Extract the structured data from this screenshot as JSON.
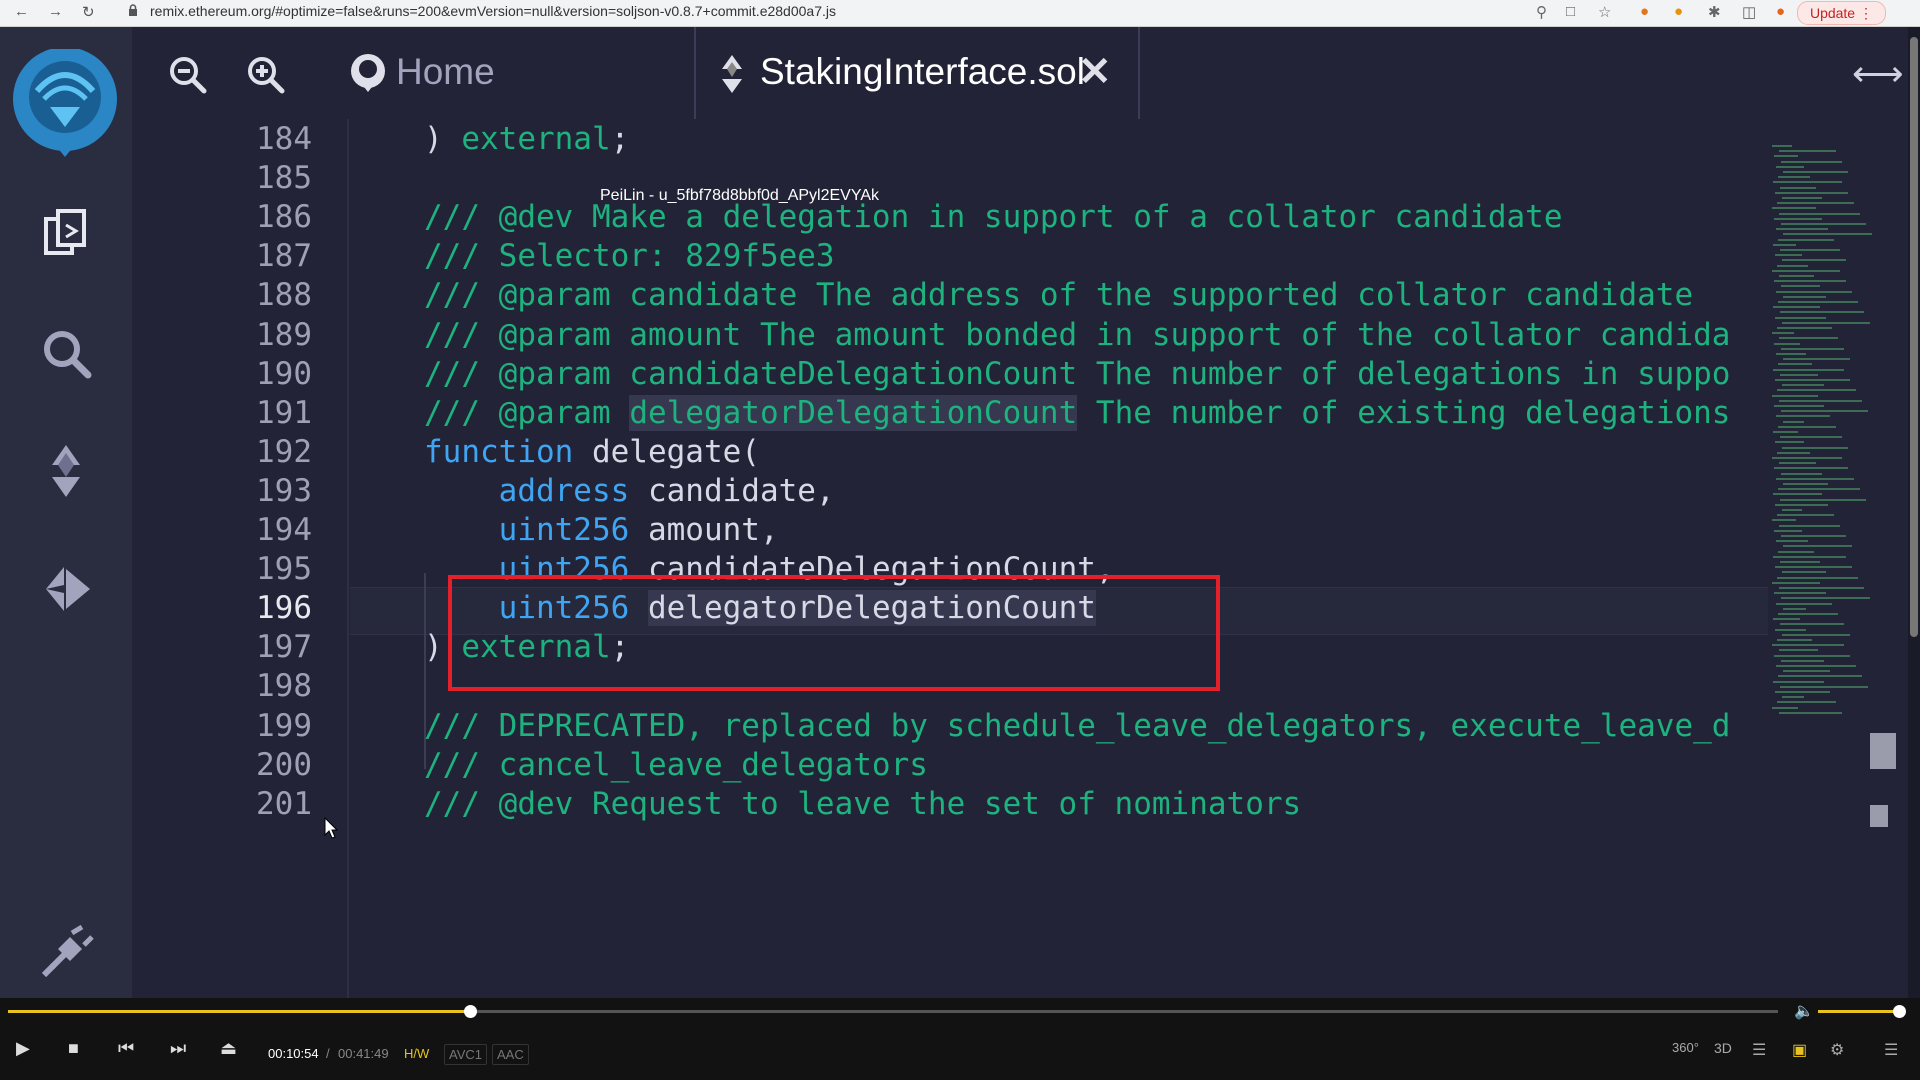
{
  "browser": {
    "url": "remix.ethereum.org/#optimize=false&runs=200&evmVersion=null&version=soljson-v0.8.7+commit.e28d00a7.js",
    "update_label": "Update"
  },
  "tabs": {
    "home_label": "Home",
    "file_label": "StakingInterface.sol"
  },
  "watermark": "PeiLin - u_5fbf78d8bbf0d_APyl2EVYAk",
  "editor": {
    "current_line": "196",
    "lines": [
      {
        "n": "184",
        "parts": [
          {
            "t": ") ",
            "c": ""
          },
          {
            "t": "external",
            "c": "cm"
          },
          {
            "t": ";",
            "c": ""
          }
        ]
      },
      {
        "n": "185",
        "parts": []
      },
      {
        "n": "186",
        "parts": [
          {
            "t": "/// @dev Make a delegation in support of a collator candidate",
            "c": "cm"
          }
        ]
      },
      {
        "n": "187",
        "parts": [
          {
            "t": "/// Selector: 829f5ee3",
            "c": "cm"
          }
        ]
      },
      {
        "n": "188",
        "parts": [
          {
            "t": "/// @param candidate The address of the supported collator candidate",
            "c": "cm"
          }
        ]
      },
      {
        "n": "189",
        "parts": [
          {
            "t": "/// @param amount The amount bonded in support of the collator candida",
            "c": "cm"
          }
        ]
      },
      {
        "n": "190",
        "parts": [
          {
            "t": "/// @param candidateDelegationCount The number of delegations in suppo",
            "c": "cm"
          }
        ]
      },
      {
        "n": "191",
        "parts": [
          {
            "t": "/// @param ",
            "c": "cm"
          },
          {
            "t": "delegatorDelegationCount",
            "c": "cm hl"
          },
          {
            "t": " The number of existing delegations",
            "c": "cm"
          }
        ]
      },
      {
        "n": "192",
        "parts": [
          {
            "t": "function",
            "c": "kw"
          },
          {
            "t": " delegate(",
            "c": ""
          }
        ]
      },
      {
        "n": "193",
        "parts": [
          {
            "t": "    ",
            "c": ""
          },
          {
            "t": "address",
            "c": "ty"
          },
          {
            "t": " candidate,",
            "c": ""
          }
        ]
      },
      {
        "n": "194",
        "parts": [
          {
            "t": "    ",
            "c": ""
          },
          {
            "t": "uint256",
            "c": "ty"
          },
          {
            "t": " amount,",
            "c": ""
          }
        ]
      },
      {
        "n": "195",
        "parts": [
          {
            "t": "    ",
            "c": ""
          },
          {
            "t": "uint256",
            "c": "ty"
          },
          {
            "t": " candidateDelegationCount,",
            "c": ""
          }
        ]
      },
      {
        "n": "196",
        "parts": [
          {
            "t": "    ",
            "c": ""
          },
          {
            "t": "uint256",
            "c": "ty"
          },
          {
            "t": " ",
            "c": ""
          },
          {
            "t": "delegatorDelegationCount",
            "c": "hl"
          }
        ]
      },
      {
        "n": "197",
        "parts": [
          {
            "t": ") ",
            "c": ""
          },
          {
            "t": "external",
            "c": "cm"
          },
          {
            "t": ";",
            "c": ""
          }
        ]
      },
      {
        "n": "198",
        "parts": []
      },
      {
        "n": "199",
        "parts": [
          {
            "t": "/// DEPRECATED, replaced by schedule_leave_delegators, execute_leave_d",
            "c": "cm"
          }
        ]
      },
      {
        "n": "200",
        "parts": [
          {
            "t": "/// cancel_leave_delegators",
            "c": "cm"
          }
        ]
      },
      {
        "n": "201",
        "parts": [
          {
            "t": "/// @dev Request to leave the set of nominators",
            "c": "cm"
          }
        ]
      }
    ]
  },
  "player": {
    "elapsed": "00:10:54",
    "separator": "/",
    "total": "00:41:49",
    "progress": 0.261,
    "volume": 0.92,
    "hw_badge": "H/W",
    "video_codec": "AVC1",
    "audio_codec": "AAC",
    "label_360": "360°",
    "label_3d": "3D"
  },
  "colors": {
    "comment": "#1eb27f",
    "keyword": "#3fa5f2",
    "highlight_box": "#e3202c",
    "progress": "#e8c21f"
  }
}
